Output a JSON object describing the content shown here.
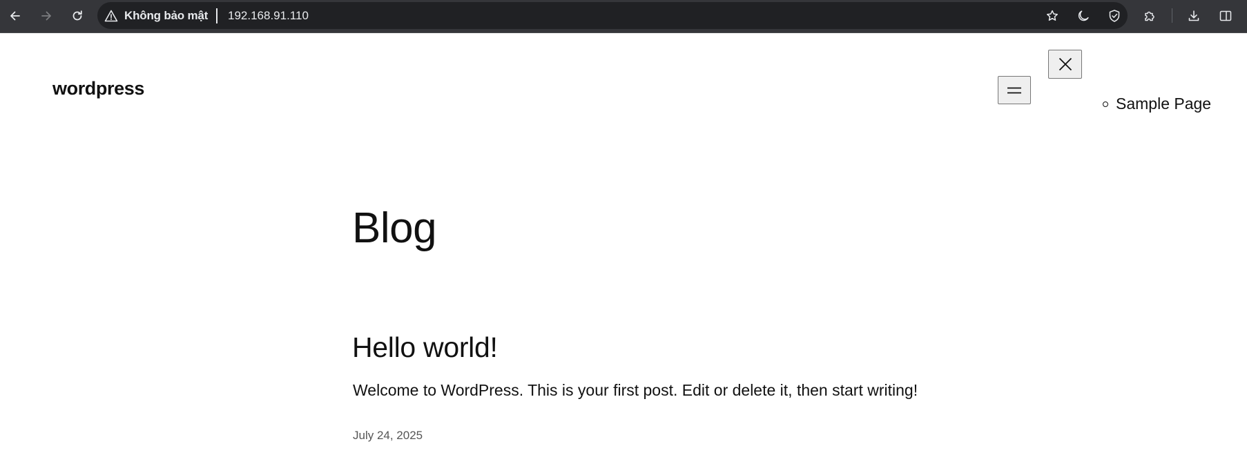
{
  "browser": {
    "nav": {
      "back_icon": "arrow-left-icon",
      "forward_icon": "arrow-right-icon",
      "reload_icon": "reload-icon"
    },
    "omnibox": {
      "security_icon": "warning-triangle-icon",
      "security_label": "Không bảo mật",
      "url": "192.168.91.110"
    },
    "actions": {
      "bookmark_icon": "star-icon",
      "dark_mode_icon": "moon-icon",
      "shield_icon": "shield-check-icon",
      "extensions_icon": "puzzle-icon",
      "download_icon": "download-icon",
      "side_panel_icon": "side-panel-icon"
    },
    "colors": {
      "toolbar": "#35363a",
      "omnibox": "#202124",
      "text": "#e8eaed"
    }
  },
  "page": {
    "site_title": "wordpress",
    "menu_button_icon": "hamburger-menu-icon",
    "close_button_icon": "close-icon",
    "nav_items": [
      {
        "label": "Sample Page"
      }
    ],
    "heading": "Blog",
    "posts": [
      {
        "title": "Hello world!",
        "excerpt": "Welcome to WordPress. This is your first post. Edit or delete it, then start writing!",
        "date": "July 24, 2025"
      }
    ]
  }
}
